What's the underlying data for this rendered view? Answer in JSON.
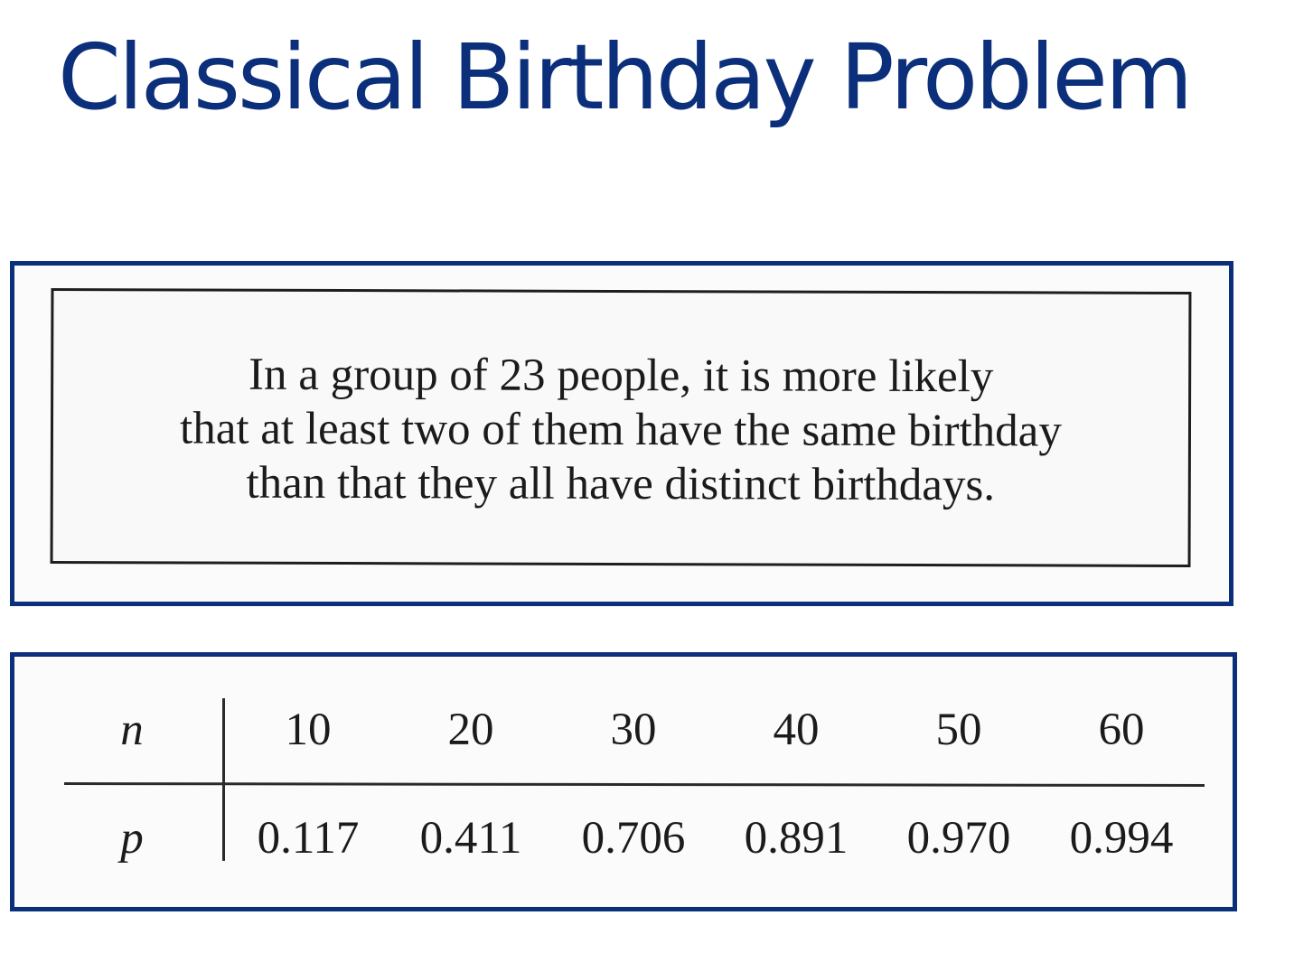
{
  "title": "Classical Birthday Problem",
  "statement": {
    "lines": [
      "In a group of 23 people, it is more likely",
      "that at least two of them have the same birthday",
      "than that they all have distinct birthdays."
    ]
  },
  "table": {
    "row_labels": [
      "n",
      "p"
    ],
    "n": [
      "10",
      "20",
      "30",
      "40",
      "50",
      "60"
    ],
    "p": [
      "0.117",
      "0.411",
      "0.706",
      "0.891",
      "0.970",
      "0.994"
    ]
  },
  "colors": {
    "title": "#0b2f7a",
    "frame": "#0b2f7a"
  }
}
